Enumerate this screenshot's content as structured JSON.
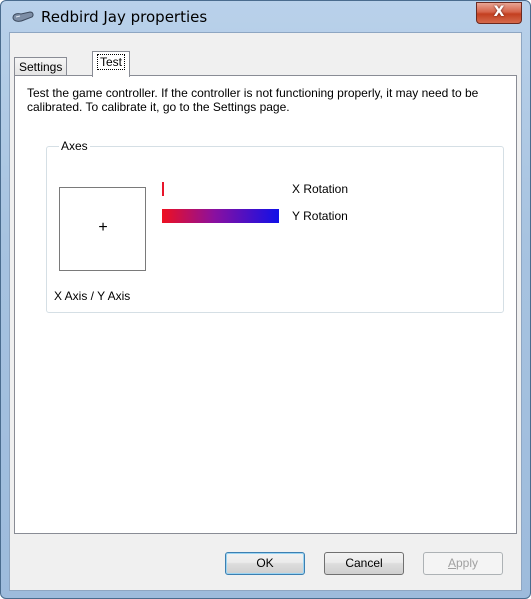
{
  "window": {
    "title": "Redbird Jay properties",
    "close_glyph": "X"
  },
  "tabs": [
    {
      "label": "Settings",
      "active": false
    },
    {
      "label": "Test",
      "active": true
    }
  ],
  "test_panel": {
    "description": "Test the game controller.  If the controller is not functioning properly, it may need to be calibrated.  To calibrate it, go to the Settings page.",
    "axes_group": {
      "label": "Axes",
      "xy_label": "X Axis / Y Axis",
      "crosshair_glyph": "+",
      "x_rotation": {
        "label": "X Rotation",
        "level": 0.02
      },
      "y_rotation": {
        "label": "Y Rotation",
        "level": 1.0
      }
    }
  },
  "buttons": {
    "ok": "OK",
    "cancel": "Cancel",
    "apply_first": "A",
    "apply_rest": "pply"
  },
  "colors": {
    "titlebar": "#a7c3e0",
    "close_button": "#c33f20",
    "bar_red": "#ee1020",
    "bar_blue": "#1010e8"
  },
  "icons": {
    "title": "game-controller-icon",
    "close": "close-icon"
  }
}
